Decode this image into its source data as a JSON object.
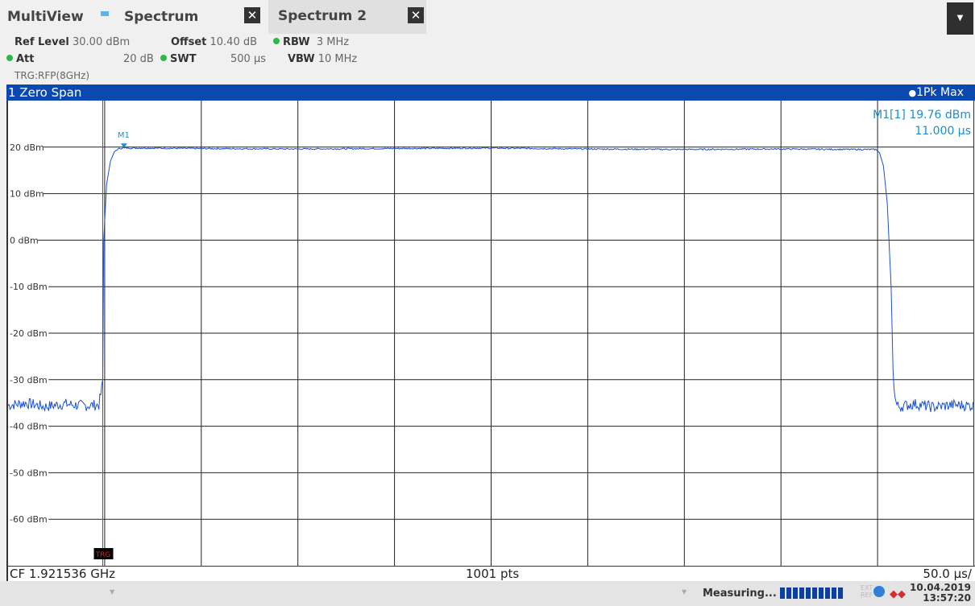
{
  "tabs": {
    "multiview_label": "MultiView",
    "spectrum_label": "Spectrum",
    "spectrum2_label": "Spectrum 2",
    "close_glyph": "✕",
    "dropdown_glyph": "▼"
  },
  "params": {
    "ref_level_label": "Ref Level",
    "ref_level_value": "30.00 dBm",
    "offset_label": "Offset",
    "offset_value": "10.40 dB",
    "rbw_label": "RBW",
    "rbw_value": "3 MHz",
    "att_label": "Att",
    "att_value": "20 dB",
    "swt_label": "SWT",
    "swt_value": "500 µs",
    "vbw_label": "VBW",
    "vbw_value": "10 MHz",
    "trigger": "TRG:RFP(8GHz)"
  },
  "diagram": {
    "title": "1 Zero Span",
    "trace_info": "1Pk Max",
    "marker_readout": "M1[1] 19.76 dBm",
    "marker_time": "11.000 µs",
    "marker_label": "M1",
    "trigger_badge": "TRG"
  },
  "footer": {
    "center_freq": "CF 1.921536 GHz",
    "points": "1001 pts",
    "time_div": "50.0 µs/"
  },
  "status": {
    "state": "Measuring...",
    "ext_ref": "EXT REF",
    "date": "10.04.2019",
    "time": "13:57:20"
  },
  "colors": {
    "accent": "#0b49b0",
    "trace": "#1a4fd6",
    "marker": "#1a8fd6",
    "trigger_line": "#e02020",
    "grid": "#222222"
  },
  "chart_data": {
    "type": "line",
    "title": "1 Zero Span",
    "x_unit": "µs",
    "xlim": [
      0,
      500
    ],
    "ylabel": "dBm",
    "ylim": [
      -70,
      30
    ],
    "y_ticks": [
      "20 dBm",
      "10 dBm",
      "0 dBm",
      "-10 dBm",
      "-20 dBm",
      "-30 dBm",
      "-40 dBm",
      "-50 dBm",
      "-60 dBm"
    ],
    "grid": true,
    "trigger_time": 0,
    "marker": {
      "name": "M1",
      "x": 11.0,
      "y": 19.76
    },
    "series": [
      {
        "name": "1Pk Max",
        "x": [
          -49,
          -40,
          -30,
          -20,
          -10,
          -2,
          -0.5,
          0,
          0.5,
          2,
          4,
          6,
          8,
          10,
          20,
          50,
          100,
          150,
          200,
          250,
          300,
          350,
          390,
          400,
          402,
          404,
          406,
          408,
          409,
          410,
          411,
          412,
          420,
          430,
          440,
          451
        ],
        "y": [
          -35.5,
          -35.0,
          -35.8,
          -35.2,
          -35.6,
          -35.4,
          -32,
          -30,
          0,
          12,
          17,
          19,
          19.6,
          19.8,
          19.8,
          19.7,
          19.6,
          19.7,
          19.8,
          19.6,
          19.5,
          19.6,
          19.5,
          19.5,
          18.8,
          16,
          8,
          -10,
          -28,
          -34,
          -35.5,
          -35.8,
          -35.2,
          -35.9,
          -35.4,
          -35.6
        ]
      }
    ]
  }
}
